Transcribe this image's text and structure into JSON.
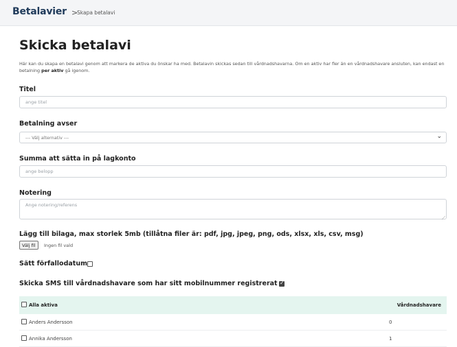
{
  "header": {
    "brand": "Betalavier",
    "separator": ">",
    "breadcrumb": "Skapa betalavi"
  },
  "page": {
    "title": "Skicka betalavi",
    "intro_part1": "Här kan du skapa en betalavi genom att markera de aktiva du önskar ha med. Betalavin skickas sedan till vårdnadshavarna. Om en aktiv har fler än en vårdnadshavare ansluten, kan endast en betalning ",
    "intro_bold": "per aktiv",
    "intro_part2": " gå igenom."
  },
  "form": {
    "title_label": "Titel",
    "title_placeholder": "ange titel",
    "payment_label": "Betalning avser",
    "payment_selected": "--- Välj alternativ ---",
    "amount_label": "Summa att sätta in på lagkonto",
    "amount_placeholder": "ange belopp",
    "note_label": "Notering",
    "note_placeholder": "Ange notering/referens",
    "attachment_label": "Lägg till bilaga, max storlek 5mb (tillåtna filer är: pdf, jpg, jpeg, png, ods, xlsx, xls, csv, msg)",
    "file_button": "Välj fil",
    "file_status": "Ingen fil vald",
    "due_date_label": "Sätt förfallodatum",
    "due_date_checked": false,
    "sms_label": "Skicka SMS till vårdnadshavare som har sitt mobilnummer registrerat",
    "sms_checked": true
  },
  "table": {
    "select_all_label": "Alla aktiva",
    "guardians_header": "Vårdnadshavare",
    "rows": [
      {
        "name": "Anders Andersson",
        "guardians": "0"
      },
      {
        "name": "Annika Andersson",
        "guardians": "1"
      }
    ]
  }
}
